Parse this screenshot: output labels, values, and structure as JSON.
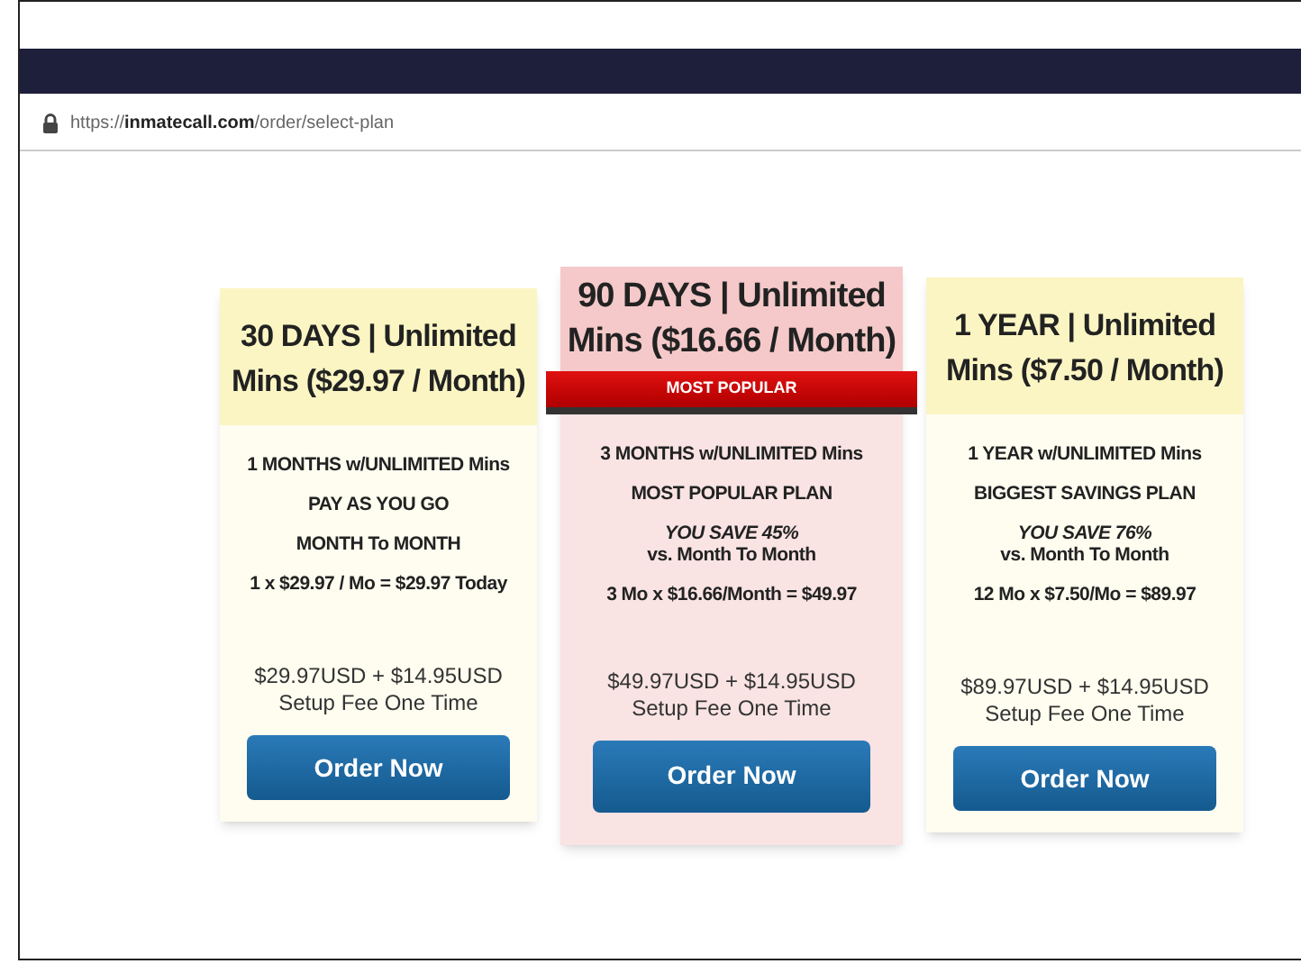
{
  "address_bar": {
    "url_scheme": "https://",
    "url_host": "inmatecall.com",
    "url_path": "/order/select-plan"
  },
  "plans": [
    {
      "title": "30 DAYS | Unlimited Mins ($29.97 / Month)",
      "featured": false,
      "features": [
        "1 MONTHS w/UNLIMITED Mins",
        "PAY AS YOU GO",
        "MONTH To MONTH",
        "1 x $29.97 / Mo = $29.97 Today"
      ],
      "price": "$29.97USD + $14.95USD\nSetup Fee One Time",
      "button": "Order Now"
    },
    {
      "title": "90 DAYS | Unlimited Mins ($16.66 / Month)",
      "featured": true,
      "ribbon": "MOST POPULAR",
      "features": [
        "3 MONTHS w/UNLIMITED Mins",
        "MOST POPULAR PLAN",
        "*YOU SAVE 45%*\nvs. Month To Month",
        "3 Mo x $16.66/Month = $49.97"
      ],
      "price": "$49.97USD + $14.95USD\nSetup Fee One Time",
      "button": "Order Now"
    },
    {
      "title": "1 YEAR | Unlimited Mins ($7.50 / Month)",
      "featured": false,
      "features": [
        "1 YEAR w/UNLIMITED Mins",
        "BIGGEST SAVINGS PLAN",
        "*YOU SAVE 76%*\nvs. Month To Month",
        "12 Mo x $7.50/Mo = $89.97"
      ],
      "price": "$89.97USD + $14.95USD\nSetup Fee One Time",
      "button": "Order Now"
    }
  ]
}
